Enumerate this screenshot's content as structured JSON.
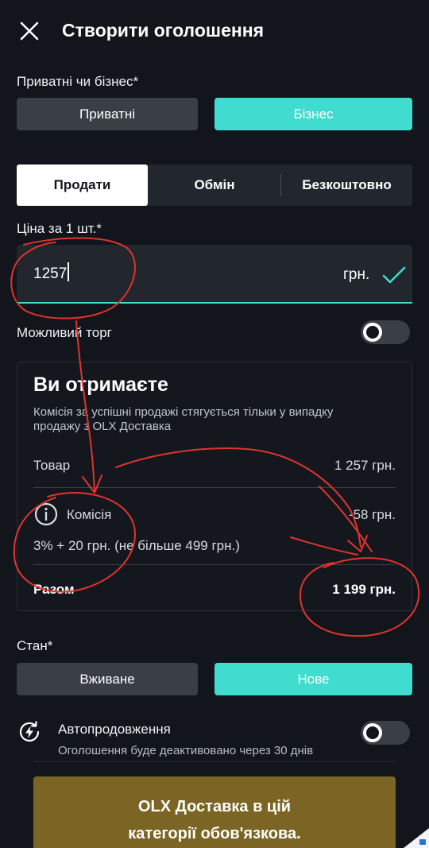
{
  "header": {
    "title": "Створити оголошення",
    "close_icon": "close-icon"
  },
  "seller_type": {
    "label": "Приватні чи бізнес*",
    "options": [
      "Приватні",
      "Бізнес"
    ],
    "selected": "Бізнес"
  },
  "deal_tabs": {
    "items": [
      "Продати",
      "Обмін",
      "Безкоштовно"
    ],
    "active": "Продати"
  },
  "price": {
    "label": "Ціна за 1 шт.*",
    "value": "1257",
    "currency": "грн."
  },
  "negotiable": {
    "label": "Можливий торг",
    "enabled": false
  },
  "receive_card": {
    "title": "Ви отримаєте",
    "description": "Комісія за успішні продажі стягується тільки у випадку продажу з OLX Доставка",
    "item_label": "Товар",
    "item_value": "1 257 грн.",
    "commission_label": "Комісія",
    "commission_value": "-58 грн.",
    "commission_note": "3% + 20 грн. (не більше 499 грн.)",
    "total_label": "Разом",
    "total_value": "1 199 грн."
  },
  "condition": {
    "label": "Стан*",
    "options": [
      "Вживане",
      "Нове"
    ],
    "selected": "Нове"
  },
  "autorenew": {
    "title": "Автопродовження",
    "subtitle": "Оголошення буде деактивовано через 30 днів",
    "enabled": false
  },
  "delivery_banner": {
    "line1": "OLX Доставка в цій",
    "line2": "категорії обов'язкова."
  },
  "colors": {
    "background": "#12151b",
    "accent": "#3fdccf",
    "annotation": "#e0342e",
    "banner": "#7c6524"
  }
}
